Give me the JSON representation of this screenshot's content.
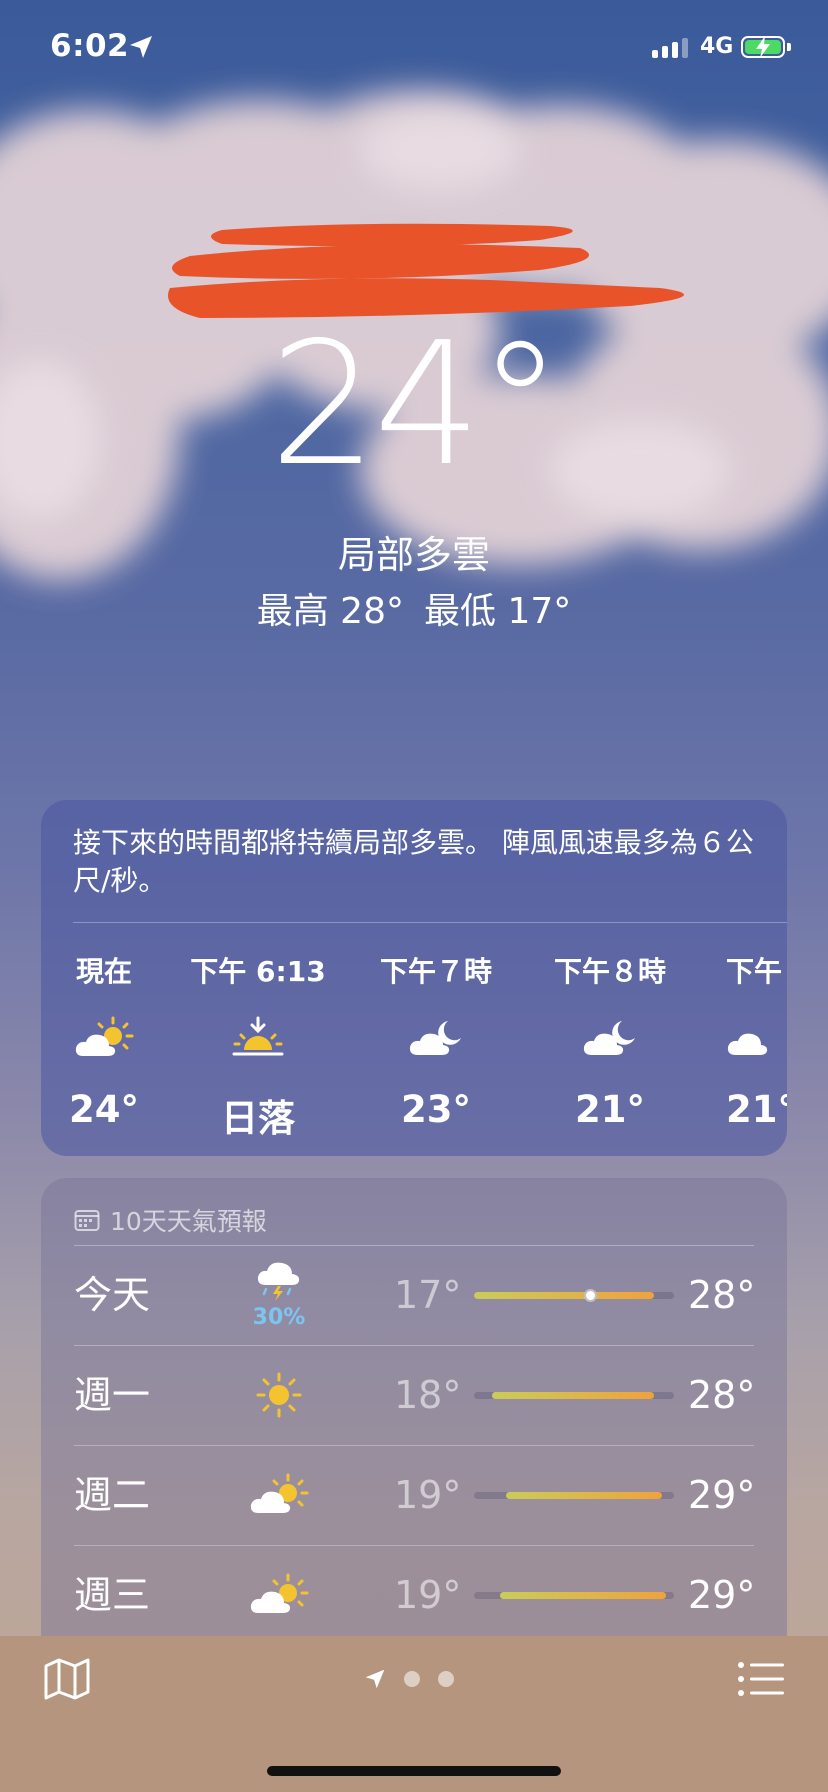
{
  "status": {
    "time": "6:02",
    "network": "4G"
  },
  "hero": {
    "temperature": "24°",
    "condition": "局部多雲",
    "high": "最高 28°",
    "low": "最低 17°"
  },
  "summary": {
    "text": "接下來的時間都將持續局部多雲。 陣風風速最多為６公尺/秒。"
  },
  "hourly": [
    {
      "label": "現在",
      "icon": "partly-sunny-icon",
      "value": "24°"
    },
    {
      "label": "下午 6:13",
      "icon": "sunset-icon",
      "value": "日落"
    },
    {
      "label": "下午７時",
      "icon": "partly-cloudy-night-icon",
      "value": "23°"
    },
    {
      "label": "下午８時",
      "icon": "partly-cloudy-night-icon",
      "value": "21°"
    },
    {
      "label": "下午",
      "icon": "partly-cloudy-night-icon",
      "value": "21°"
    }
  ],
  "ten_day": {
    "title": "10天天氣預報",
    "rows": [
      {
        "day": "今天",
        "icon": "thunderstorm-icon",
        "precip": "30%",
        "low": "17°",
        "high": "28°",
        "range_start": 0.0,
        "range_end": 0.9,
        "current": 0.58
      },
      {
        "day": "週一",
        "icon": "sun-icon",
        "precip": "",
        "low": "18°",
        "high": "28°",
        "range_start": 0.09,
        "range_end": 0.9
      },
      {
        "day": "週二",
        "icon": "partly-sunny-icon",
        "precip": "",
        "low": "19°",
        "high": "29°",
        "range_start": 0.16,
        "range_end": 0.94
      },
      {
        "day": "週三",
        "icon": "partly-sunny-icon",
        "precip": "",
        "low": "19°",
        "high": "29°",
        "range_start": 0.13,
        "range_end": 0.96
      }
    ]
  },
  "colors": {
    "accent_precip": "#7ec4f0",
    "bar_cool": "#c9cc5a",
    "bar_warm": "#f0a23c",
    "redaction": "#e8532a"
  }
}
